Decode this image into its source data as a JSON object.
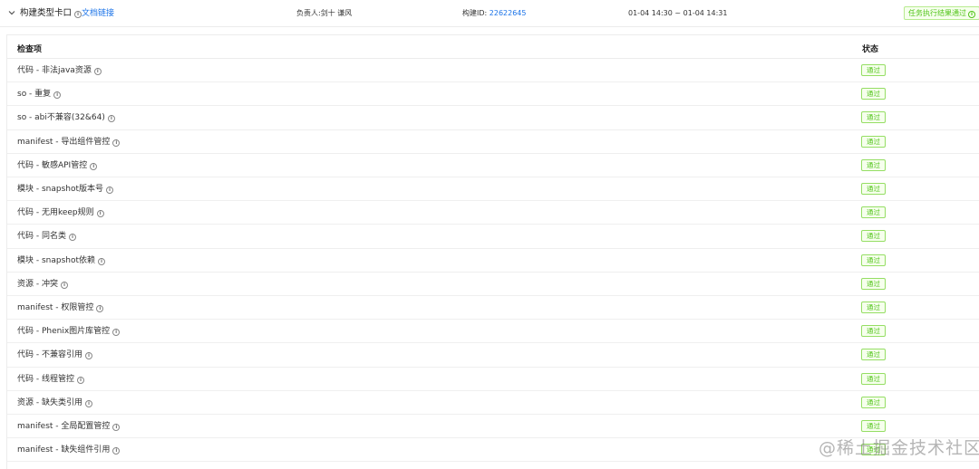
{
  "header": {
    "title": "构建类型卡口",
    "doc_link": "文档链接",
    "owner": "负责人:剑十  谦风",
    "build_label": "构建ID: ",
    "build_id": "22622645",
    "time_range": "01-04 14:30 ~ 01-04 14:31",
    "result_badge": "任务执行结果通过"
  },
  "table": {
    "columns": [
      "检查项",
      "状态"
    ],
    "rows": [
      {
        "name": "代码 - 非法java资源",
        "status": "通过"
      },
      {
        "name": "so - 重复",
        "status": "通过"
      },
      {
        "name": "so - abi不兼容(32&64)",
        "status": "通过"
      },
      {
        "name": "manifest - 导出组件管控",
        "status": "通过"
      },
      {
        "name": "代码 - 敏感API管控",
        "status": "通过"
      },
      {
        "name": "模块 - snapshot版本号",
        "status": "通过"
      },
      {
        "name": "代码 - 无用keep规则",
        "status": "通过"
      },
      {
        "name": "代码 - 同名类",
        "status": "通过"
      },
      {
        "name": "模块 - snapshot依赖",
        "status": "通过"
      },
      {
        "name": "资源 - 冲突",
        "status": "通过"
      },
      {
        "name": "manifest - 权限管控",
        "status": "通过"
      },
      {
        "name": "代码 - Phenix图片库管控",
        "status": "通过"
      },
      {
        "name": "代码 - 不兼容引用",
        "status": "通过"
      },
      {
        "name": "代码 - 线程管控",
        "status": "通过"
      },
      {
        "name": "资源 - 缺失类引用",
        "status": "通过"
      },
      {
        "name": "manifest - 全局配置管控",
        "status": "通过"
      },
      {
        "name": "manifest - 缺失组件引用",
        "status": "通过"
      }
    ]
  },
  "watermark": "@稀土掘金技术社区",
  "icons": {
    "collapse": "chevron-down-icon",
    "info": "info-circle-icon"
  },
  "colors": {
    "link": "#1a73e8",
    "success": "#52c41a",
    "success_bg": "#f6ffed"
  }
}
